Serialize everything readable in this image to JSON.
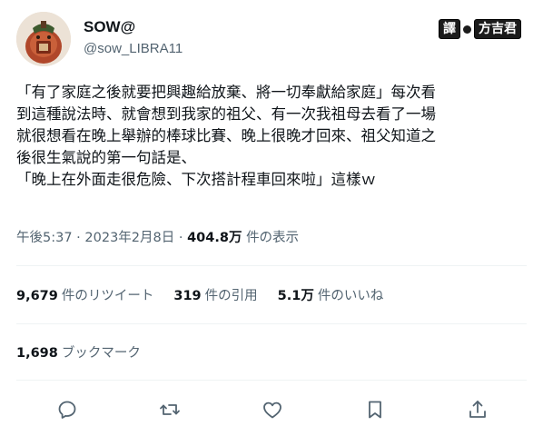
{
  "author": {
    "display_name": "SOW@",
    "handle": "@sow_LIBRA11"
  },
  "translator_tag": {
    "prefix": "譯",
    "name": "方吉君"
  },
  "tweet": {
    "lines": [
      "「有了家庭之後就要把興趣給放棄、將一切奉獻給家庭」每次看",
      "到這種說法時、就會想到我家的祖父、有一次我祖母去看了一場",
      "就很想看在晚上舉辦的棒球比賽、晚上很晚才回來、祖父知道之",
      "後很生氣說的第一句話是、",
      "「晚上在外面走很危險、下次搭計程車回來啦」這樣ｗ"
    ]
  },
  "meta": {
    "time": "午後5:37",
    "separator": "·",
    "date": "2023年2月8日",
    "views_count": "404.8万",
    "views_label": "件の表示"
  },
  "stats": {
    "retweets": {
      "count": "9,679",
      "label": "件のリツイート"
    },
    "quotes": {
      "count": "319",
      "label": "件の引用"
    },
    "likes": {
      "count": "5.1万",
      "label": "件のいいね"
    }
  },
  "bookmarks": {
    "count": "1,698",
    "label": "ブックマーク"
  },
  "actions": {
    "reply_icon": "reply-icon",
    "retweet_icon": "retweet-icon",
    "like_icon": "heart-icon",
    "bookmark_icon": "bookmark-icon",
    "share_icon": "share-icon",
    "icon_color": "#536471"
  },
  "colors": {
    "text_primary": "#0f1419",
    "text_secondary": "#536471",
    "divider": "#eff3f4"
  }
}
